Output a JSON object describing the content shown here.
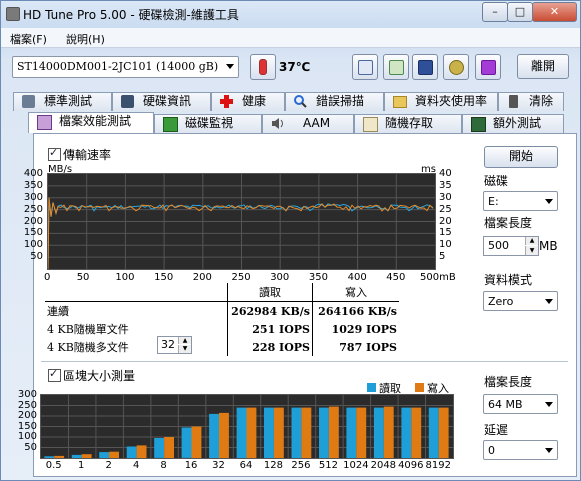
{
  "window": {
    "title": "HD Tune Pro  5.00 - 硬碟檢測-維護工具",
    "min_label": "–",
    "max_label": "□",
    "close_label": "✕"
  },
  "menu": {
    "file": "檔案(F)",
    "help": "說明(H)"
  },
  "toolbar": {
    "drive": "ST14000DM001-2JC101 (14000 gB)",
    "temperature": "37℃",
    "exit_label": "離開",
    "icons": [
      "copy-text-icon",
      "copy-screenshot-icon",
      "save-icon",
      "options-icon",
      "download-icon"
    ]
  },
  "tabs_top": [
    "標準測試",
    "硬碟資訊",
    "健康",
    "錯誤掃描",
    "資料夾使用率",
    "清除"
  ],
  "tabs_bottom": [
    "檔案效能測試",
    "磁碟監視",
    "AAM",
    "隨機存取",
    "額外測試"
  ],
  "transfer": {
    "checkbox_label": "傳輸速率",
    "left_unit": "MB/s",
    "right_unit": "ms",
    "left_ticks": [
      "400",
      "350",
      "300",
      "250",
      "200",
      "150",
      "100",
      "50"
    ],
    "right_ticks": [
      "40",
      "35",
      "30",
      "25",
      "20",
      "15",
      "10",
      "5"
    ],
    "x_ticks": [
      "0",
      "50",
      "100",
      "150",
      "200",
      "250",
      "300",
      "350",
      "400",
      "450",
      "500mB"
    ]
  },
  "results": {
    "read_header": "讀取",
    "write_header": "寫入",
    "rows": [
      {
        "label": "連續",
        "read": "262984 KB/s",
        "write": "264166 KB/s"
      },
      {
        "label": "4 KB隨機單文件",
        "read": "251 IOPS",
        "write": "1029 IOPS"
      },
      {
        "label": "4 KB隨機多文件",
        "read": "228 IOPS",
        "write": "787 IOPS"
      }
    ],
    "queue_depth": "32"
  },
  "side": {
    "start_label": "開始",
    "drive_label": "磁碟",
    "drive_value": "E:",
    "file_length_label": "檔案長度",
    "file_length_value": "500",
    "file_length_unit": "MB",
    "data_mode_label": "資料模式",
    "data_mode_value": "Zero"
  },
  "blocksize": {
    "checkbox_label": "區塊大小測量",
    "legend_read": "讀取",
    "legend_write": "寫入",
    "file_length_label": "檔案長度",
    "file_length_value": "64 MB",
    "delay_label": "延遲",
    "delay_value": "0",
    "y_ticks": [
      "300",
      "250",
      "200",
      "150",
      "100",
      "50"
    ]
  },
  "chart_data": {
    "type": "bar",
    "categories": [
      "0.5",
      "1",
      "2",
      "4",
      "8",
      "16",
      "32",
      "64",
      "128",
      "256",
      "512",
      "1024",
      "2048",
      "4096",
      "8192"
    ],
    "series": [
      {
        "name": "讀取",
        "color": "#1e9fd8",
        "values": [
          8,
          15,
          28,
          55,
          95,
          145,
          210,
          240,
          240,
          240,
          240,
          240,
          240,
          240,
          240
        ]
      },
      {
        "name": "寫入",
        "color": "#e07b14",
        "values": [
          10,
          18,
          30,
          60,
          100,
          150,
          215,
          240,
          240,
          240,
          245,
          240,
          245,
          240,
          240
        ]
      }
    ],
    "ylim": [
      0,
      300
    ],
    "legend": "top-right"
  },
  "colors": {
    "read": "#1e9fd8",
    "write": "#e07b14",
    "trace_read": "#2aa7de",
    "trace_write": "#e58a2a",
    "graph_bg": "#2b2b2b"
  }
}
